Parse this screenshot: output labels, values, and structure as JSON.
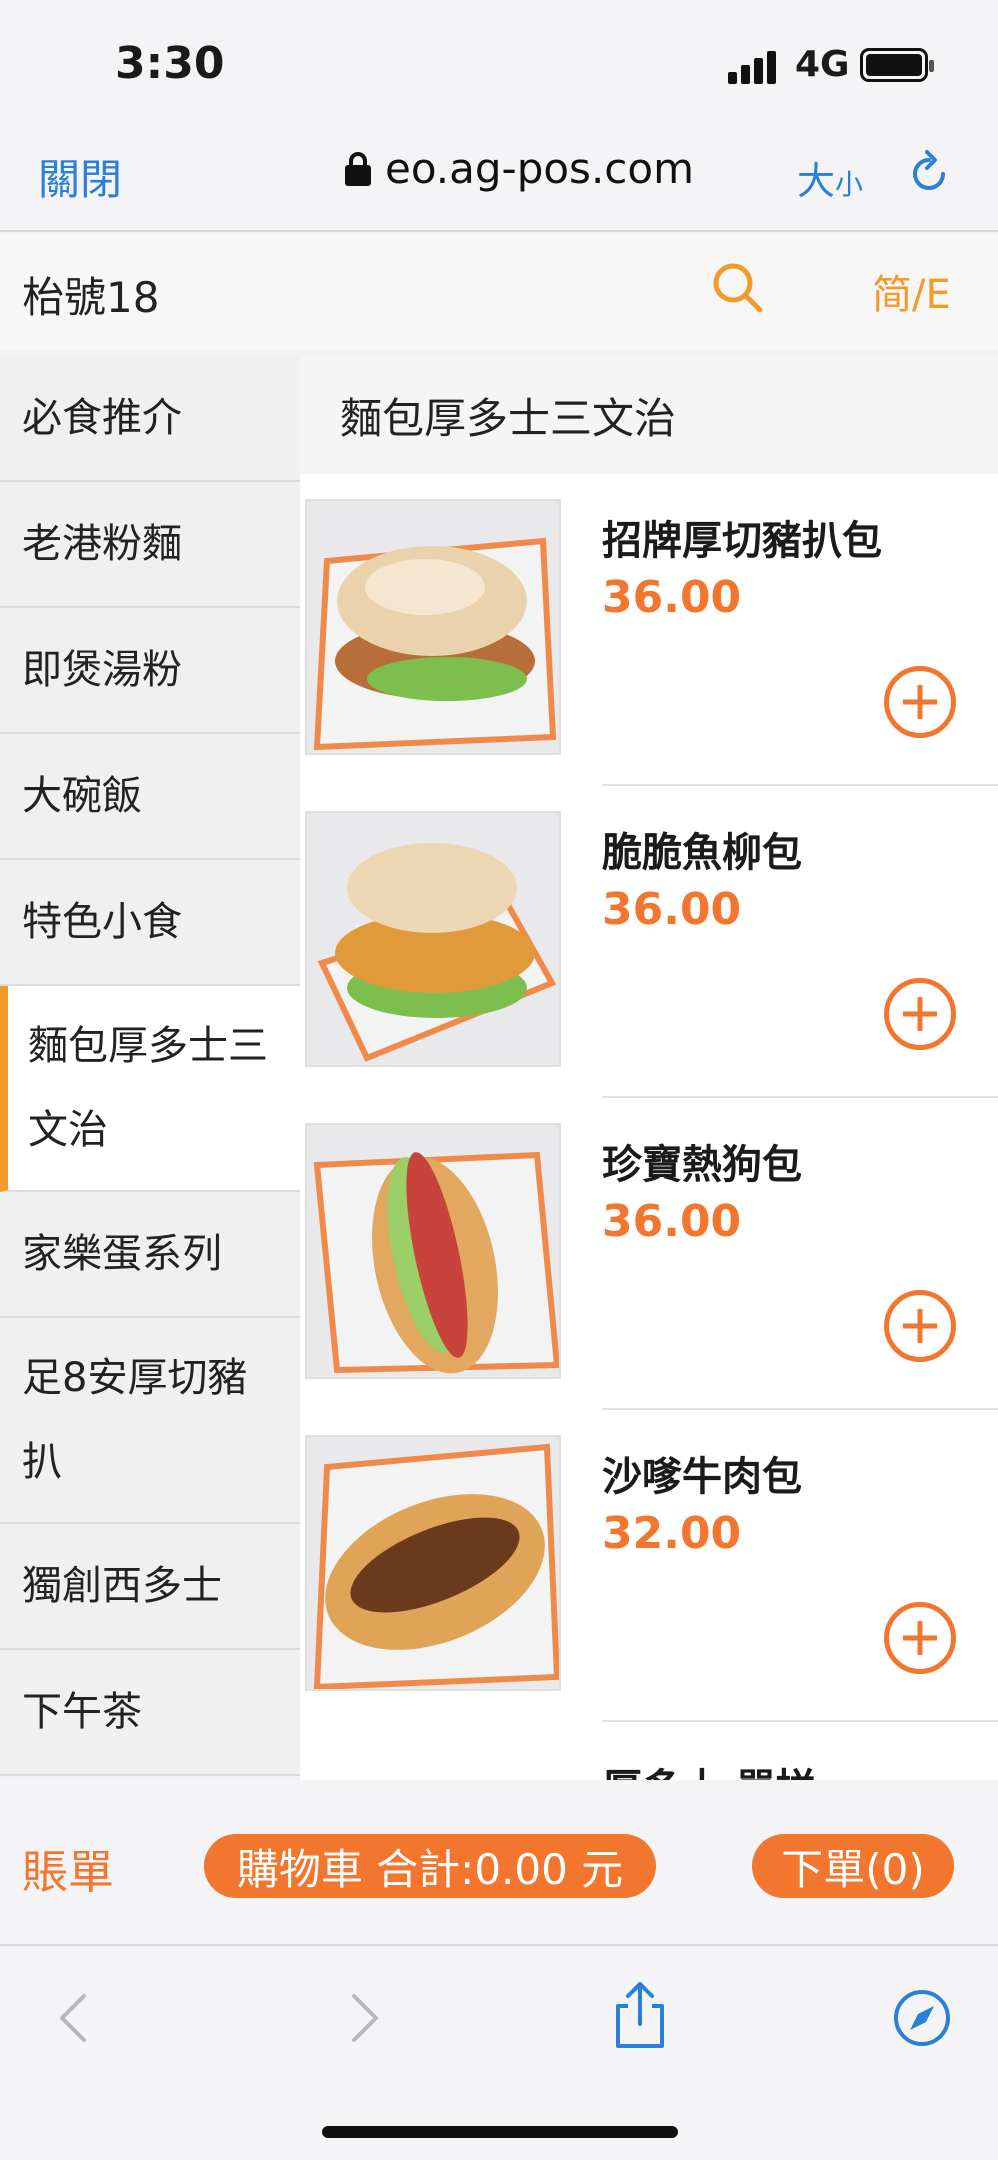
{
  "status_bar": {
    "time": "3:30",
    "network": "4G"
  },
  "browser": {
    "close_label": "關閉",
    "url": "eo.ag-pos.com",
    "size_label_big": "大",
    "size_label_small": "小"
  },
  "header": {
    "store_name": "枱號18",
    "lang_label": "简/E"
  },
  "sidebar": {
    "categories": [
      {
        "label": "必食推介"
      },
      {
        "label": "老港粉麵"
      },
      {
        "label": "即煲湯粉"
      },
      {
        "label": "大碗飯"
      },
      {
        "label": "特色小食"
      },
      {
        "label": "麵包厚多士三文治",
        "active": true
      },
      {
        "label": "家樂蛋系列"
      },
      {
        "label": "足8安厚切豬扒"
      },
      {
        "label": "獨創西多士"
      },
      {
        "label": "下午茶"
      }
    ]
  },
  "content": {
    "section_title": "麵包厚多士三文治",
    "items": [
      {
        "name": "招牌厚切豬扒包",
        "price": "36.00"
      },
      {
        "name": "脆脆魚柳包",
        "price": "36.00"
      },
      {
        "name": "珍寶熱狗包",
        "price": "36.00"
      },
      {
        "name": "沙嗲牛肉包",
        "price": "32.00"
      },
      {
        "name": "厚多士 單拼"
      }
    ]
  },
  "actions": {
    "bill_label": "賬單",
    "cart_label": "購物車 合計:0.00 元",
    "order_label": "下單(0)"
  },
  "colors": {
    "accent": "#f2762e",
    "link": "#2a7fd6",
    "lang": "#f39a2b"
  }
}
